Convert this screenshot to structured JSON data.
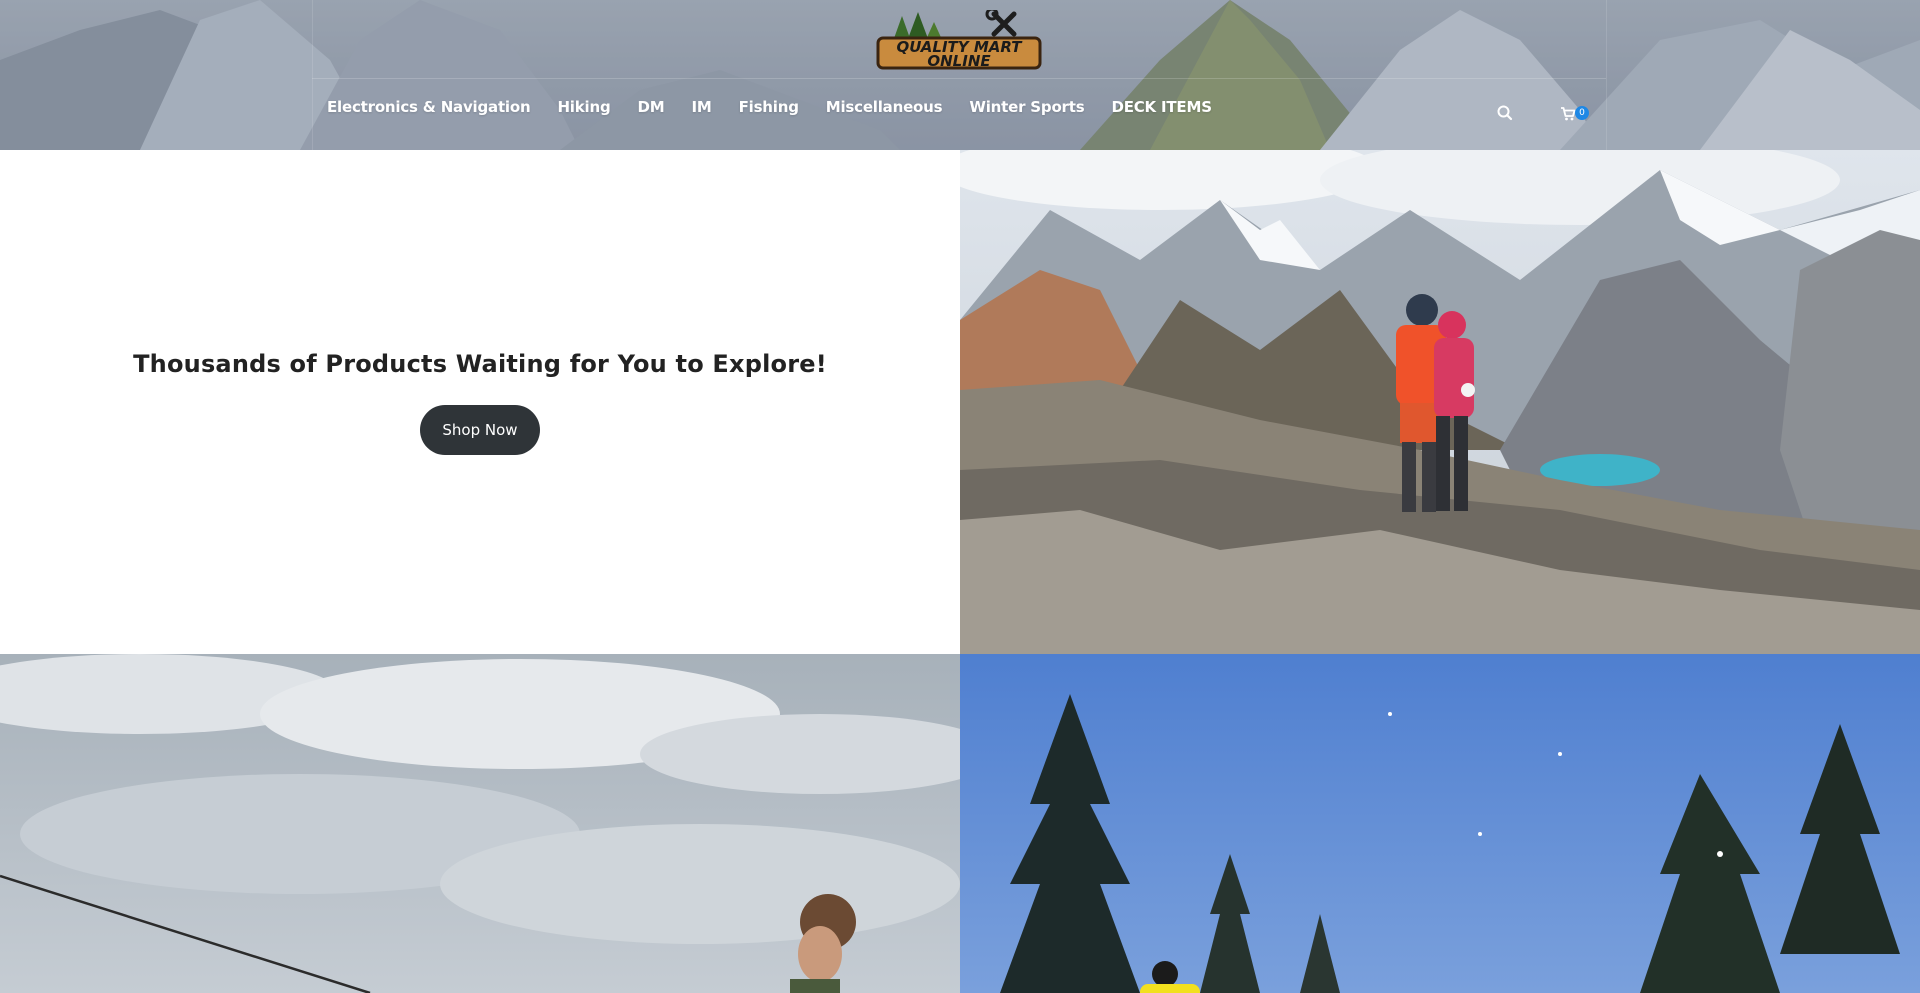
{
  "brand": {
    "logo_text_line1": "QUALITY MART",
    "logo_text_line2": "ONLINE"
  },
  "nav": {
    "items": [
      {
        "label": "Electronics & Navigation"
      },
      {
        "label": "Hiking"
      },
      {
        "label": "DM"
      },
      {
        "label": "IM"
      },
      {
        "label": "Fishing"
      },
      {
        "label": "Miscellaneous"
      },
      {
        "label": "Winter Sports"
      },
      {
        "label": "DECK ITEMS"
      }
    ]
  },
  "header_icons": {
    "search": "search-icon",
    "cart": "cart-icon",
    "cart_count": "0"
  },
  "hero": {
    "title": "Thousands of Products Waiting for You to Explore!",
    "button_label": "Shop Now"
  },
  "images": [
    {
      "name": "hikers-mountain-photo",
      "subject": "two hikers on a mountain ridge"
    },
    {
      "name": "fishing-photo",
      "subject": "man with fishing rod under cloudy sky"
    },
    {
      "name": "skiing-photo",
      "subject": "skier among snowy pine trees"
    }
  ],
  "colors": {
    "header_bg": "#8e98a6",
    "button_bg": "#2f3438",
    "badge": "#1e88e5",
    "text": "#222222"
  }
}
